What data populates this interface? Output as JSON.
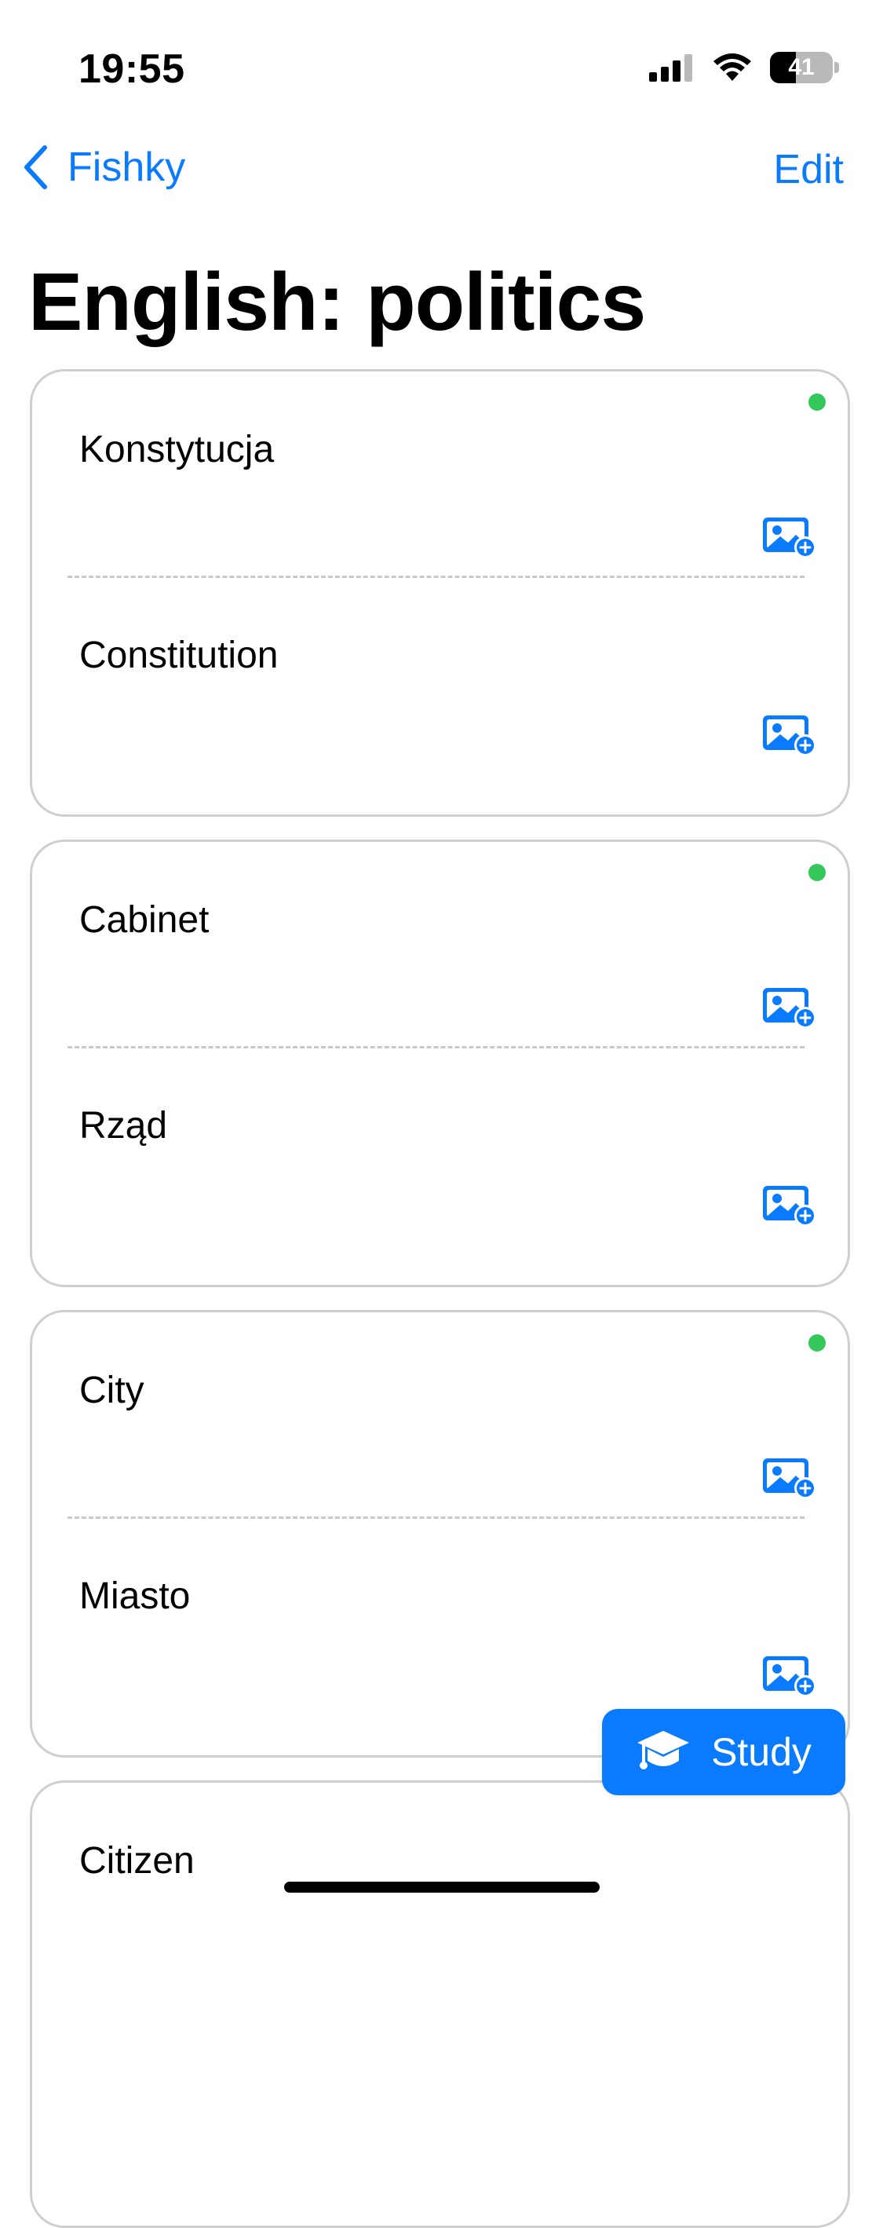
{
  "status_bar": {
    "time": "19:55",
    "battery_level": "41",
    "battery_fraction": 0.41,
    "icons": [
      "cellular-signal-icon",
      "wifi-icon",
      "battery-icon"
    ]
  },
  "nav": {
    "back_label": "Fishky",
    "edit_label": "Edit",
    "back_icon": "chevron-left-icon"
  },
  "title": "English: politics",
  "colors": {
    "accent": "#0a7aff",
    "dot": "#34c759",
    "card_border": "#cfcfcf"
  },
  "cards": [
    {
      "front": "Konstytucja",
      "back": "Constitution"
    },
    {
      "front": "Cabinet",
      "back": "Rząd"
    },
    {
      "front": "City",
      "back": "Miasto"
    },
    {
      "front": "Citizen",
      "back": ""
    }
  ],
  "study_button": {
    "label": "Study",
    "icon": "graduation-cap-icon"
  }
}
